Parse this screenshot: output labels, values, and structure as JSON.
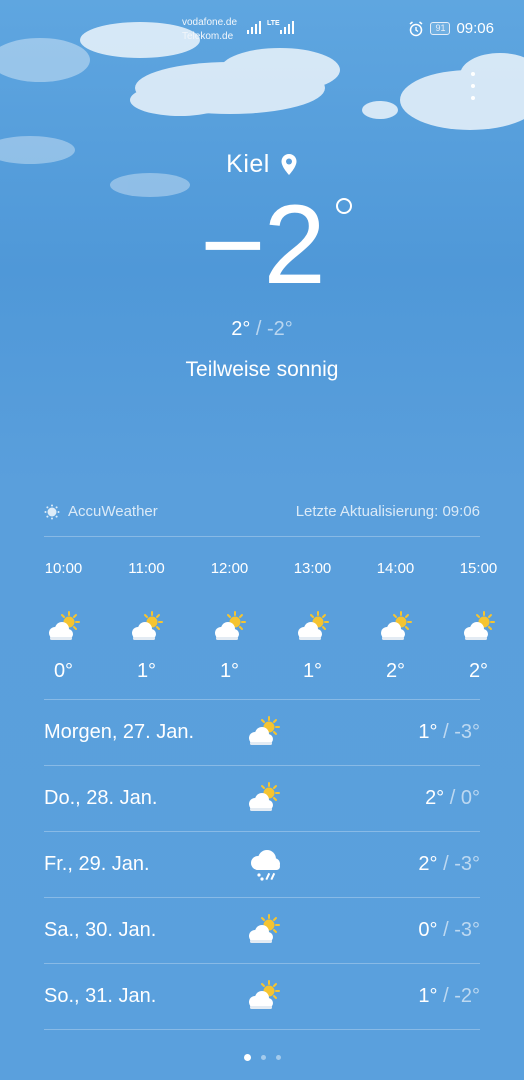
{
  "status": {
    "carrier1": "vodafone.de",
    "carrier2": "Telekom.de",
    "network": "LTE",
    "battery": "91",
    "time": "09:06"
  },
  "location": {
    "city": "Kiel",
    "icon": "location-pin-icon"
  },
  "current": {
    "temp": "−2",
    "high": "2°",
    "low": "-2°",
    "separator": "/",
    "condition": "Teilweise sonnig"
  },
  "provider": {
    "name": "AccuWeather",
    "updated": "Letzte Aktualisierung: 09:06"
  },
  "hourly": [
    {
      "time": "10:00",
      "temp": "0°",
      "icon": "partly-sunny-icon"
    },
    {
      "time": "11:00",
      "temp": "1°",
      "icon": "partly-sunny-icon"
    },
    {
      "time": "12:00",
      "temp": "1°",
      "icon": "partly-sunny-icon"
    },
    {
      "time": "13:00",
      "temp": "1°",
      "icon": "partly-sunny-icon"
    },
    {
      "time": "14:00",
      "temp": "2°",
      "icon": "partly-sunny-icon"
    },
    {
      "time": "15:00",
      "temp": "2°",
      "icon": "partly-sunny-icon"
    }
  ],
  "daily": [
    {
      "label": "Morgen, 27. Jan.",
      "high": "1°",
      "low": "-3°",
      "icon": "partly-sunny-icon"
    },
    {
      "label": "Do., 28. Jan.",
      "high": "2°",
      "low": "0°",
      "icon": "partly-sunny-icon"
    },
    {
      "label": "Fr., 29. Jan.",
      "high": "2°",
      "low": "-3°",
      "icon": "snow-sleet-icon"
    },
    {
      "label": "Sa., 30. Jan.",
      "high": "0°",
      "low": "-3°",
      "icon": "partly-sunny-icon"
    },
    {
      "label": "So., 31. Jan.",
      "high": "1°",
      "low": "-2°",
      "icon": "partly-sunny-icon"
    }
  ],
  "pager": {
    "pages": 3,
    "active": 0
  },
  "colors": {
    "sky": "#5a9fdc",
    "sun": "#f5c430",
    "cloud": "#ffffff"
  }
}
